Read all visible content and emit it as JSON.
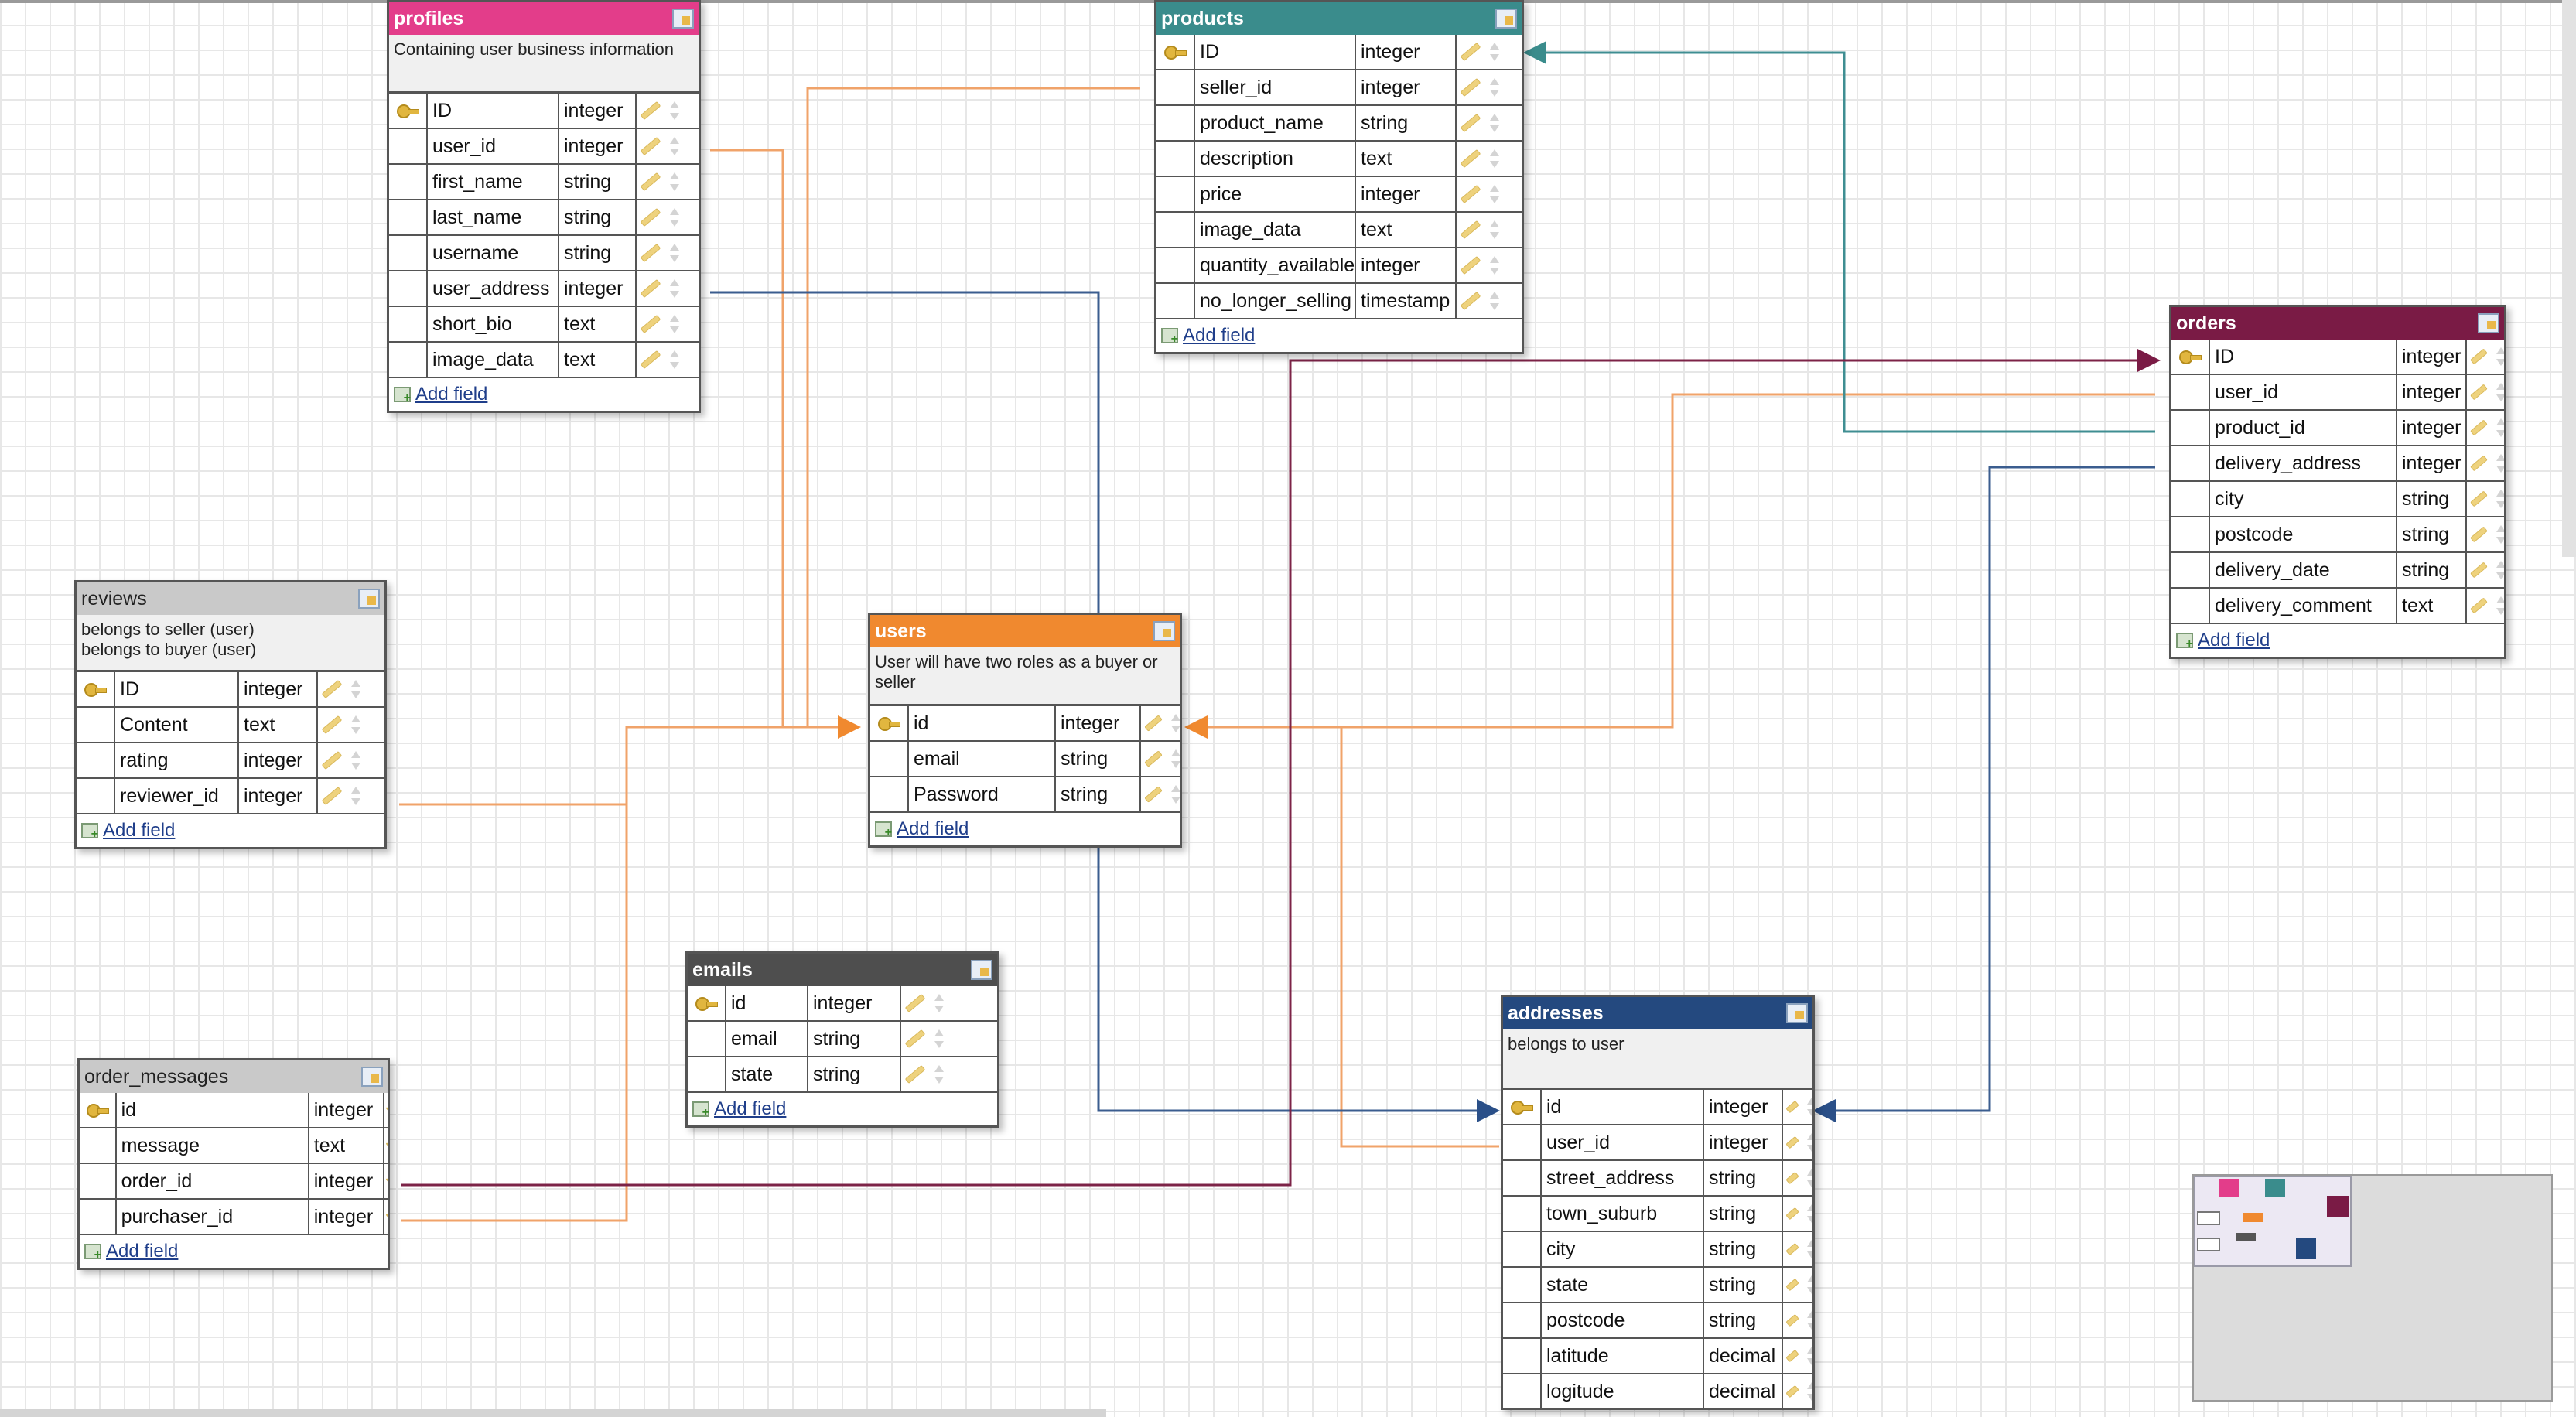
{
  "colors": {
    "profiles": "#e33d8a",
    "products": "#3a8c8c",
    "orders": "#7a1b45",
    "reviews": "#c9c9c9",
    "users": "#f0892f",
    "emails": "#4e4e4e",
    "order_messages": "#c9c9c9",
    "addresses": "#24497f",
    "line_orange": "#f0a36a",
    "line_blue": "#3b5d8f",
    "line_teal": "#3f8e92",
    "line_maroon": "#7c2347"
  },
  "icons": {
    "edit": "edit-table-icon",
    "key": "primary-key-icon",
    "pencil": "pencil-icon",
    "reorder": "reorder-arrows-icon",
    "add": "add-field-icon"
  },
  "add_field_label": "Add field",
  "tables": {
    "profiles": {
      "name": "profiles",
      "comment": "Containing user business information",
      "fields": [
        {
          "name": "ID",
          "type": "integer",
          "pk": true
        },
        {
          "name": "user_id",
          "type": "integer",
          "pk": false
        },
        {
          "name": "first_name",
          "type": "string",
          "pk": false
        },
        {
          "name": "last_name",
          "type": "string",
          "pk": false
        },
        {
          "name": "username",
          "type": "string",
          "pk": false
        },
        {
          "name": "user_address",
          "type": "integer",
          "pk": false
        },
        {
          "name": "short_bio",
          "type": "text",
          "pk": false
        },
        {
          "name": "image_data",
          "type": "text",
          "pk": false
        }
      ]
    },
    "products": {
      "name": "products",
      "comment": "",
      "fields": [
        {
          "name": "ID",
          "type": "integer",
          "pk": true
        },
        {
          "name": "seller_id",
          "type": "integer",
          "pk": false
        },
        {
          "name": "product_name",
          "type": "string",
          "pk": false
        },
        {
          "name": "description",
          "type": "text",
          "pk": false
        },
        {
          "name": "price",
          "type": "integer",
          "pk": false
        },
        {
          "name": "image_data",
          "type": "text",
          "pk": false
        },
        {
          "name": "quantity_available",
          "type": "integer",
          "pk": false
        },
        {
          "name": "no_longer_selling",
          "type": "timestamp",
          "pk": false
        }
      ]
    },
    "orders": {
      "name": "orders",
      "comment": "",
      "fields": [
        {
          "name": "ID",
          "type": "integer",
          "pk": true
        },
        {
          "name": "user_id",
          "type": "integer",
          "pk": false
        },
        {
          "name": "product_id",
          "type": "integer",
          "pk": false
        },
        {
          "name": "delivery_address",
          "type": "integer",
          "pk": false
        },
        {
          "name": "city",
          "type": "string",
          "pk": false
        },
        {
          "name": "postcode",
          "type": "string",
          "pk": false
        },
        {
          "name": "delivery_date",
          "type": "string",
          "pk": false
        },
        {
          "name": "delivery_comment",
          "type": "text",
          "pk": false
        }
      ]
    },
    "reviews": {
      "name": "reviews",
      "comment": "belongs to seller (user)\nbelongs to buyer (user)",
      "fields": [
        {
          "name": "ID",
          "type": "integer",
          "pk": true
        },
        {
          "name": "Content",
          "type": "text",
          "pk": false
        },
        {
          "name": "rating",
          "type": "integer",
          "pk": false
        },
        {
          "name": "reviewer_id",
          "type": "integer",
          "pk": false
        }
      ]
    },
    "users": {
      "name": "users",
      "comment": "User will have two roles as a buyer or seller",
      "fields": [
        {
          "name": "id",
          "type": "integer",
          "pk": true
        },
        {
          "name": "email",
          "type": "string",
          "pk": false
        },
        {
          "name": "Password",
          "type": "string",
          "pk": false
        }
      ]
    },
    "emails": {
      "name": "emails",
      "comment": "",
      "fields": [
        {
          "name": "id",
          "type": "integer",
          "pk": true
        },
        {
          "name": "email",
          "type": "string",
          "pk": false
        },
        {
          "name": "state",
          "type": "string",
          "pk": false
        }
      ]
    },
    "order_messages": {
      "name": "order_messages",
      "comment": "",
      "fields": [
        {
          "name": "id",
          "type": "integer",
          "pk": true
        },
        {
          "name": "message",
          "type": "text",
          "pk": false
        },
        {
          "name": "order_id",
          "type": "integer",
          "pk": false
        },
        {
          "name": "purchaser_id",
          "type": "integer",
          "pk": false
        }
      ]
    },
    "addresses": {
      "name": "addresses",
      "comment": "belongs to user",
      "fields": [
        {
          "name": "id",
          "type": "integer",
          "pk": true
        },
        {
          "name": "user_id",
          "type": "integer",
          "pk": false
        },
        {
          "name": "street_address",
          "type": "string",
          "pk": false
        },
        {
          "name": "town_suburb",
          "type": "string",
          "pk": false
        },
        {
          "name": "city",
          "type": "string",
          "pk": false
        },
        {
          "name": "state",
          "type": "string",
          "pk": false
        },
        {
          "name": "postcode",
          "type": "string",
          "pk": false
        },
        {
          "name": "latitude",
          "type": "decimal",
          "pk": false
        },
        {
          "name": "logitude",
          "type": "decimal",
          "pk": false
        }
      ]
    }
  }
}
